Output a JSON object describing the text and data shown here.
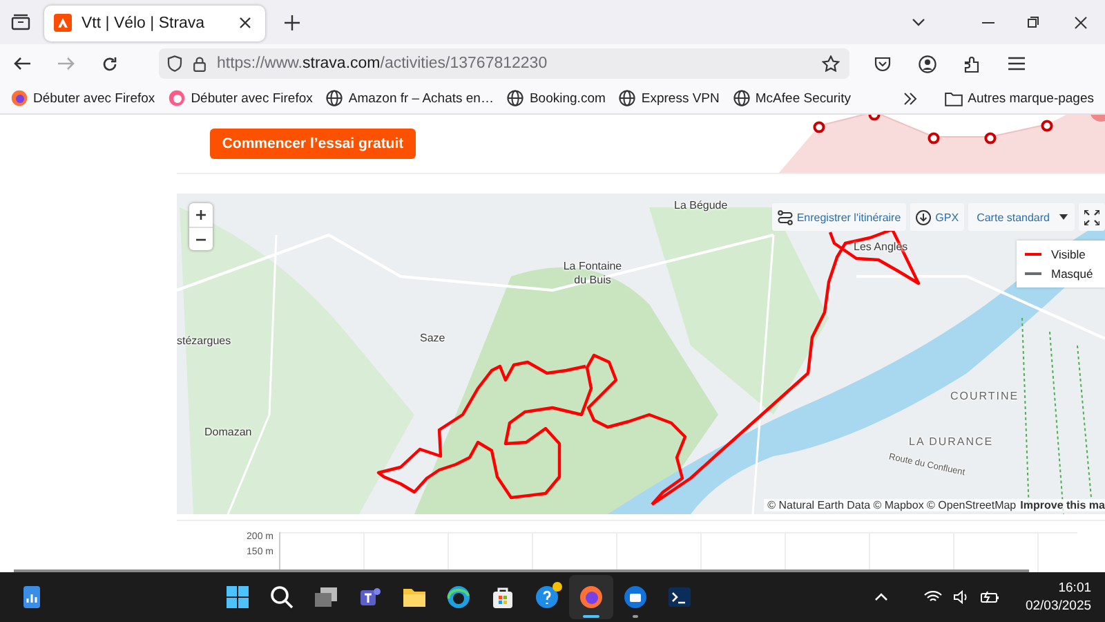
{
  "browser": {
    "tabs": [
      {
        "title": "Vtt | Vélo | Strava",
        "selected": true
      }
    ],
    "nav": {
      "forward_disabled": true
    },
    "url": {
      "prefix": "https://www.",
      "domain": "strava.com",
      "path": "/activities/13767812230"
    },
    "bookmarks": [
      {
        "label": "Débuter avec Firefox",
        "kind": "firefox"
      },
      {
        "label": "Débuter avec Firefox",
        "kind": "nightly"
      },
      {
        "label": "Amazon fr – Achats en…",
        "kind": "globe"
      },
      {
        "label": "Booking.com",
        "kind": "globe"
      },
      {
        "label": "Express VPN",
        "kind": "globe"
      },
      {
        "label": "McAfee Security",
        "kind": "globe"
      }
    ],
    "other_bookmarks": "Autres marque-pages"
  },
  "page": {
    "trial_button": "Commencer l’essai gratuit",
    "map": {
      "save_route": "Enregistrer l'itinéraire",
      "gpx": "GPX",
      "style": "Carte standard",
      "legend": [
        {
          "label": "Visible",
          "color": "#ff0000"
        },
        {
          "label": "Masqué",
          "color": "#6b6b75"
        }
      ],
      "places": [
        {
          "name": "La Bégude",
          "kind": "town"
        },
        {
          "name": "La Fontaine du Buis",
          "kind": "town"
        },
        {
          "name": "Saze",
          "kind": "town"
        },
        {
          "name": "stézargues",
          "kind": "town"
        },
        {
          "name": "Domazan",
          "kind": "town"
        },
        {
          "name": "Les Angles",
          "kind": "town"
        },
        {
          "name": "COURTINE",
          "kind": "district"
        },
        {
          "name": "LA DURANCE",
          "kind": "district"
        },
        {
          "name": "Route du Confluent",
          "kind": "road"
        }
      ],
      "attribution": "© Natural Earth Data © Mapbox © OpenStreetMap",
      "attribution_link": "Improve this ma"
    },
    "elevation_labels": [
      "200 m",
      "150 m"
    ]
  },
  "taskbar": {
    "apps": [
      {
        "kind": "start",
        "selected": false,
        "running": false,
        "badge": false
      },
      {
        "kind": "search",
        "selected": false,
        "running": false,
        "badge": false
      },
      {
        "kind": "taskview",
        "selected": false,
        "running": false,
        "badge": false
      },
      {
        "kind": "teams",
        "selected": false,
        "running": false,
        "badge": false
      },
      {
        "kind": "explorer",
        "selected": false,
        "running": false,
        "badge": false
      },
      {
        "kind": "edge",
        "selected": false,
        "running": false,
        "badge": false
      },
      {
        "kind": "store",
        "selected": false,
        "running": false,
        "badge": false
      },
      {
        "kind": "help",
        "selected": false,
        "running": false,
        "badge": true
      },
      {
        "kind": "firefox",
        "selected": true,
        "running": true,
        "badge": false
      },
      {
        "kind": "thunderbird",
        "selected": false,
        "running": true,
        "badge": false
      },
      {
        "kind": "terminal",
        "selected": false,
        "running": false,
        "badge": false
      }
    ],
    "time": "16:01",
    "date": "02/03/2025"
  }
}
